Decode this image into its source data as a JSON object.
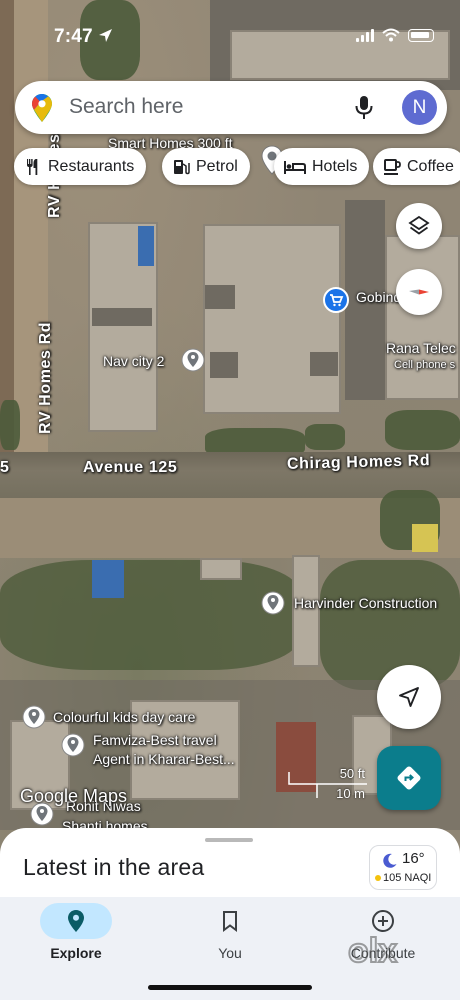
{
  "status_bar": {
    "time": "7:47"
  },
  "search": {
    "placeholder": "Search here",
    "avatar_initial": "N"
  },
  "chips": [
    {
      "label": "Restaurants",
      "icon": "fork-knife-icon"
    },
    {
      "label": "Petrol",
      "icon": "fuel-pump-icon"
    },
    {
      "label": "Hotels",
      "icon": "bed-icon"
    },
    {
      "label": "Coffee",
      "icon": "coffee-cup-icon"
    }
  ],
  "map": {
    "roads": {
      "rv_homes_top": "RV Homes Rd",
      "rv_homes_mid": "RV Homes Rd",
      "avenue": "Avenue 125",
      "chirag": "Chirag Homes Rd",
      "edge_5": "5"
    },
    "places": {
      "smart_homes": "Smart Homes 300 ft",
      "gobind_mart": "Gobind Mart",
      "rana_telecom": "Rana Telec",
      "cell_phone": "Cell phone s",
      "nav_city": "Nav city 2",
      "harvinder": "Harvinder Construction",
      "colourful": "Colourful kids day care",
      "famviza_1": "Famviza-Best travel",
      "famviza_2": "Agent in Kharar-Best...",
      "rohit": "Rohit Niwas",
      "shanti": "Shanti homes"
    },
    "scale": {
      "feet": "50 ft",
      "meters": "10 m"
    },
    "logo": "Google Maps"
  },
  "sheet": {
    "title": "Latest in the area",
    "weather": {
      "temp": "16°",
      "aqi": "105 NAQI"
    }
  },
  "nav": [
    {
      "label": "Explore",
      "icon": "location-pin-icon",
      "active": true
    },
    {
      "label": "You",
      "icon": "bookmark-icon",
      "active": false
    },
    {
      "label": "Contribute",
      "icon": "add-circle-icon",
      "active": false
    }
  ],
  "watermark": "olx",
  "colors": {
    "accent_teal": "#0b7d8c",
    "avatar": "#5e6bd1",
    "active_pill": "#c2e7ff",
    "poi_blue": "#1a73e8"
  }
}
